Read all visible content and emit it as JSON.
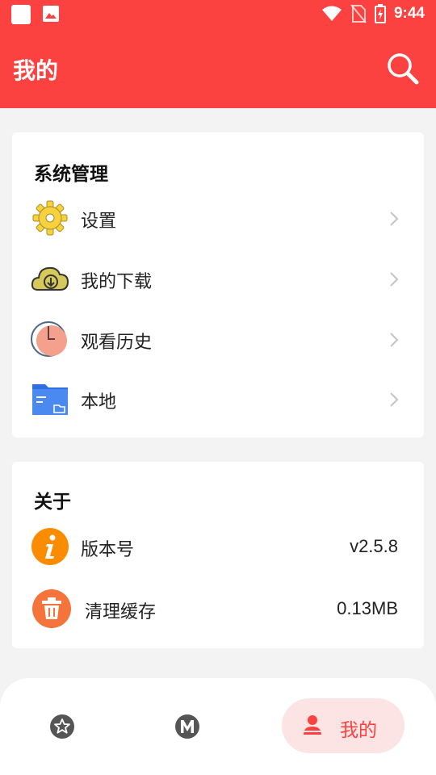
{
  "status_bar": {
    "time": "9:44"
  },
  "appbar": {
    "title": "我的",
    "search_icon": "search-icon"
  },
  "colors": {
    "accent": "#fc4141",
    "nav_active_bg": "#fde4e4"
  },
  "system_section": {
    "title": "系统管理",
    "items": [
      {
        "label": "设置",
        "icon": "gear-icon"
      },
      {
        "label": "我的下载",
        "icon": "cloud-download-icon"
      },
      {
        "label": "观看历史",
        "icon": "clock-icon"
      },
      {
        "label": "本地",
        "icon": "folder-icon"
      }
    ]
  },
  "about_section": {
    "title": "关于",
    "items": [
      {
        "label": "版本号",
        "value": "v2.5.8",
        "icon": "info-icon"
      },
      {
        "label": "清理缓存",
        "value": "0.13MB",
        "icon": "trash-icon"
      }
    ]
  },
  "bottom_nav": {
    "items": [
      {
        "name": "favorites",
        "icon": "star-badge-icon"
      },
      {
        "name": "m",
        "icon": "m-badge-icon"
      },
      {
        "name": "mine",
        "label": "我的",
        "icon": "person-icon",
        "active": true
      }
    ]
  }
}
